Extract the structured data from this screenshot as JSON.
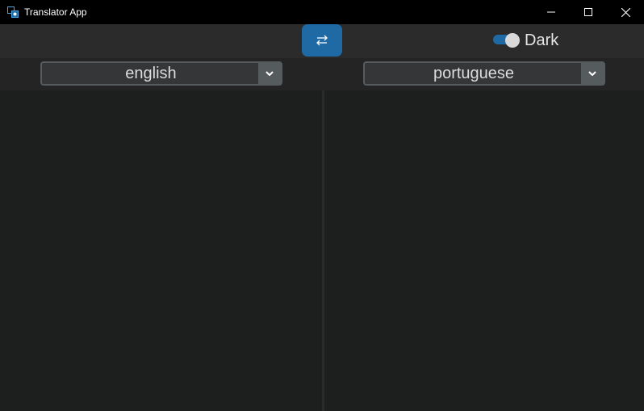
{
  "window": {
    "title": "Translator App",
    "controls": [
      "minimize",
      "maximize",
      "close"
    ]
  },
  "toolbar": {
    "swap_icon": "swap-arrows-icon",
    "theme_switch": {
      "label": "Dark",
      "on": true
    }
  },
  "languages": {
    "source": "english",
    "target": "portuguese"
  },
  "panels": {
    "source_text": "",
    "target_text": ""
  },
  "colors": {
    "accent": "#1f6aa5",
    "background": "#242424",
    "panel": "#1d1e1e",
    "combo_bg": "#343638",
    "combo_border": "#565b5e"
  }
}
